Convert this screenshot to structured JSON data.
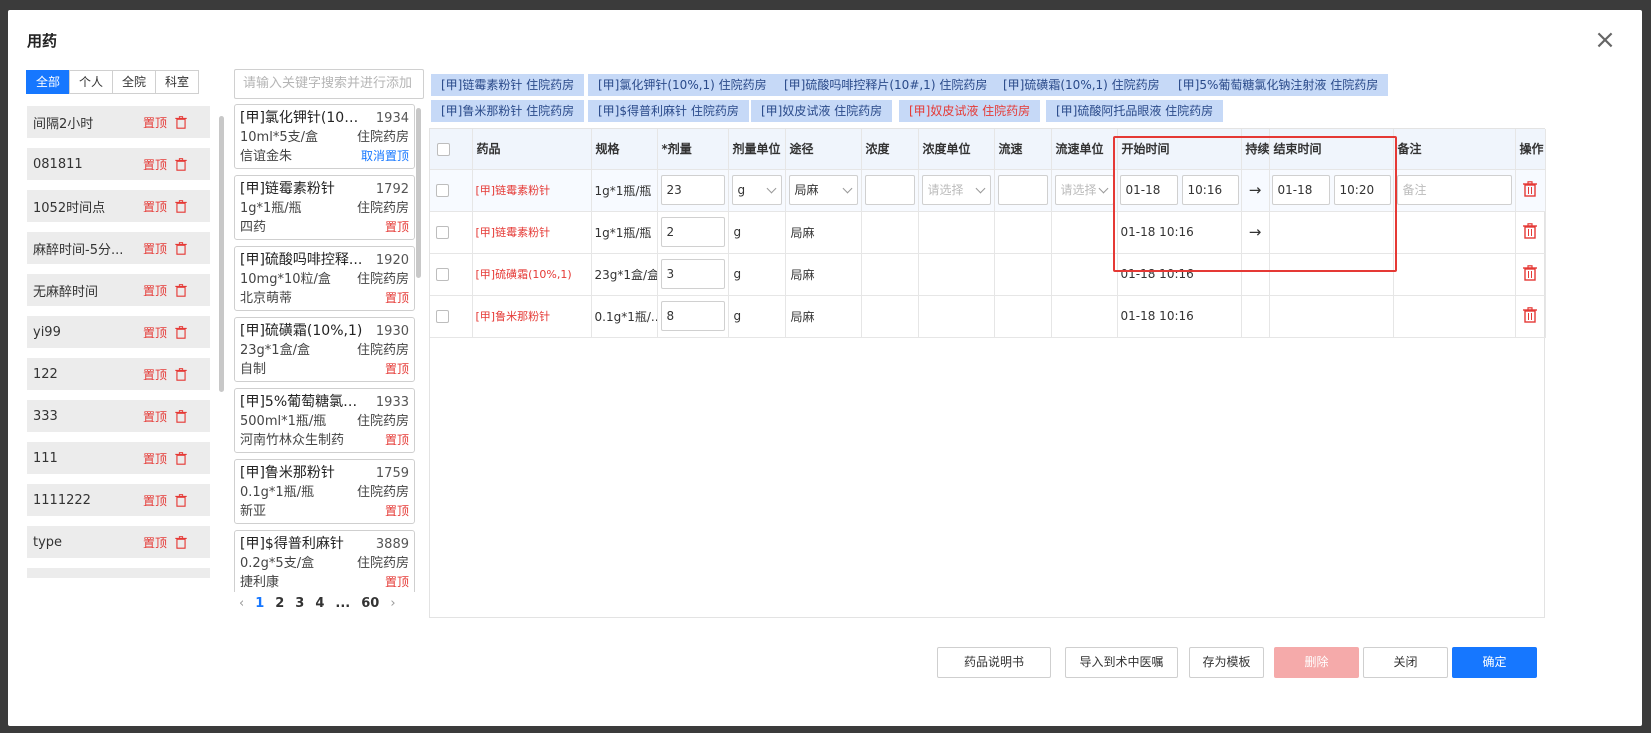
{
  "dialog": {
    "title": "用药",
    "close_symbol": "×"
  },
  "scope_tabs": [
    "全部",
    "个人",
    "全院",
    "科室"
  ],
  "templates": [
    {
      "label": "间隔2小时",
      "pin": "置顶"
    },
    {
      "label": "081811",
      "pin": "置顶"
    },
    {
      "label": "1052时间点",
      "pin": "置顶"
    },
    {
      "label": "麻醉时间-5分...",
      "pin": "置顶"
    },
    {
      "label": "无麻醉时间",
      "pin": "置顶"
    },
    {
      "label": "yi99",
      "pin": "置顶"
    },
    {
      "label": "122",
      "pin": "置顶"
    },
    {
      "label": "333",
      "pin": "置顶"
    },
    {
      "label": "111",
      "pin": "置顶"
    },
    {
      "label": "1111222",
      "pin": "置顶"
    },
    {
      "label": "type",
      "pin": "置顶"
    }
  ],
  "search": {
    "placeholder": "请输入关键字搜索并进行添加"
  },
  "drugs": [
    {
      "name": "[甲]氯化钾针(10%,1)",
      "code": "1934",
      "spec": "10ml*5支/盒",
      "pharmacy": "住院药房",
      "maker": "信谊金朱",
      "pin": "取消置顶"
    },
    {
      "name": "[甲]链霉素粉针",
      "code": "1792",
      "spec": "1g*1瓶/瓶",
      "pharmacy": "住院药房",
      "maker": "四药",
      "pin": "置顶"
    },
    {
      "name": "[甲]硫酸吗啡控释...",
      "code": "1920",
      "spec": "10mg*10粒/盒",
      "pharmacy": "住院药房",
      "maker": "北京萌蒂",
      "pin": "置顶"
    },
    {
      "name": "[甲]硫磺霜(10%,1)",
      "code": "1930",
      "spec": "23g*1盒/盒",
      "pharmacy": "住院药房",
      "maker": "自制",
      "pin": "置顶"
    },
    {
      "name": "[甲]5%葡萄糖氯化...",
      "code": "1933",
      "spec": "500ml*1瓶/瓶",
      "pharmacy": "住院药房",
      "maker": "河南竹林众生制药",
      "pin": "置顶"
    },
    {
      "name": "[甲]鲁米那粉针",
      "code": "1759",
      "spec": "0.1g*1瓶/瓶",
      "pharmacy": "住院药房",
      "maker": "新亚",
      "pin": "置顶"
    },
    {
      "name": "[甲]$得普利麻针",
      "code": "3889",
      "spec": "0.2g*5支/盒",
      "pharmacy": "住院药房",
      "maker": "捷利康",
      "pin": "置顶"
    }
  ],
  "pager": {
    "prev": "‹",
    "pages": [
      "1",
      "2",
      "3",
      "4",
      "...",
      "60"
    ],
    "next": "›",
    "current": "1"
  },
  "chips": [
    {
      "label": "[甲]链霉素粉针 住院药房",
      "red": false
    },
    {
      "label": "[甲]氯化钾针(10%,1) 住院药房",
      "red": false
    },
    {
      "label": "[甲]硫酸吗啡控释片(10#,1) 住院药房",
      "red": false
    },
    {
      "label": "[甲]硫磺霜(10%,1) 住院药房",
      "red": false
    },
    {
      "label": "[甲]5%葡萄糖氯化钠注射液 住院药房",
      "red": false
    },
    {
      "label": "[甲]鲁米那粉针 住院药房",
      "red": false
    },
    {
      "label": "[甲]$得普利麻针 住院药房",
      "red": false
    },
    {
      "label": "[甲]奴皮试液 住院药房",
      "red": false
    },
    {
      "label": "[甲]奴皮试液 住院药房",
      "red": true
    },
    {
      "label": "[甲]硫酸阿托品眼液 住院药房",
      "red": false
    }
  ],
  "table": {
    "headers": [
      "药品",
      "规格",
      "*剂量",
      "剂量单位",
      "途径",
      "浓度",
      "浓度单位",
      "流速",
      "流速单位",
      "开始时间",
      "持续",
      "结束时间",
      "备注",
      "操作"
    ],
    "edit_row": {
      "drug": "[甲]链霉素粉针",
      "spec": "1g*1瓶/瓶",
      "dose": "23",
      "unit": "g",
      "route": "局麻",
      "conc_unit_ph": "请选择",
      "flow_unit_ph": "请选择",
      "start_date": "01-18",
      "start_time": "10:16",
      "arrow": "→",
      "end_date": "01-18",
      "end_time": "10:20",
      "remark_ph": "备注"
    },
    "rows": [
      {
        "drug": "[甲]链霉素粉针",
        "spec": "1g*1瓶/瓶",
        "dose": "2",
        "unit": "g",
        "route": "局麻",
        "start": "01-18 10:16",
        "arrow": "→"
      },
      {
        "drug": "[甲]硫磺霜(10%,1)",
        "spec": "23g*1盒/盒",
        "dose": "3",
        "unit": "g",
        "route": "局麻",
        "start": "01-18 10:16",
        "arrow": ""
      },
      {
        "drug": "[甲]鲁米那粉针",
        "spec": "0.1g*1瓶/...",
        "dose": "8",
        "unit": "g",
        "route": "局麻",
        "start": "01-18 10:16",
        "arrow": ""
      }
    ]
  },
  "footer": {
    "manual": "药品说明书",
    "import": "导入到术中医嘱",
    "save_template": "存为模板",
    "delete": "删除",
    "close": "关闭",
    "confirm": "确定"
  },
  "colors": {
    "primary": "#1677ff",
    "danger": "#e53935",
    "chip_bg": "#c6d9f7"
  }
}
